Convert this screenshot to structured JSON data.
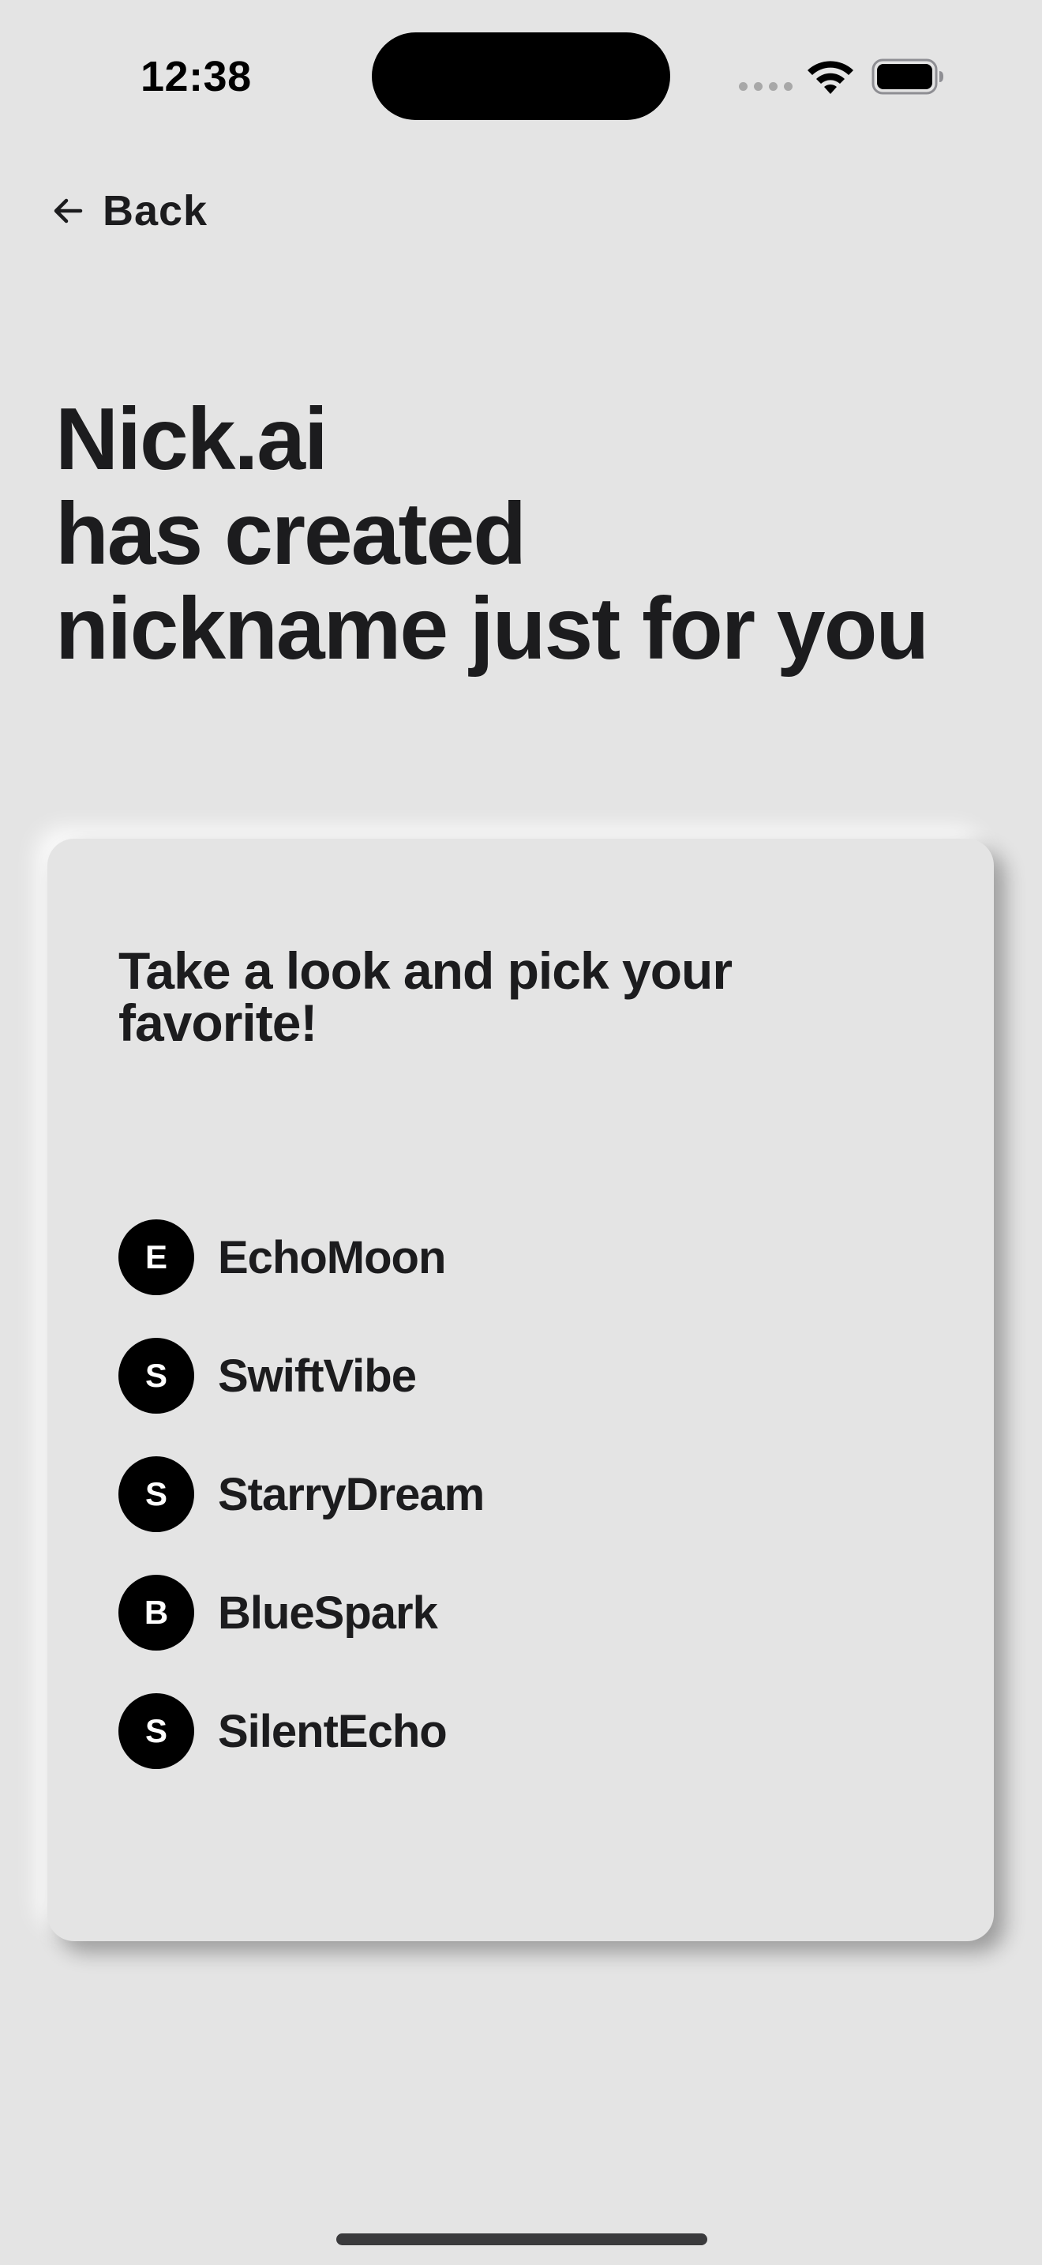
{
  "status_bar": {
    "time": "12:38"
  },
  "nav": {
    "back_label": "Back"
  },
  "header": {
    "lines": [
      "Nick.ai",
      "has created",
      "nickname just for you"
    ]
  },
  "card": {
    "title": "Take a look and pick your favorite!",
    "nicknames": [
      {
        "initial": "E",
        "name": "EchoMoon"
      },
      {
        "initial": "S",
        "name": "SwiftVibe"
      },
      {
        "initial": "S",
        "name": "StarryDream"
      },
      {
        "initial": "B",
        "name": "BlueSpark"
      },
      {
        "initial": "S",
        "name": "SilentEcho"
      }
    ]
  },
  "icons": {
    "back": "arrow-left-icon",
    "wifi": "wifi-icon",
    "battery": "battery-icon",
    "signal": "signal-dots-icon"
  },
  "colors": {
    "background": "#e4e4e4",
    "text": "#1c1c1e",
    "avatar": "#000000"
  }
}
